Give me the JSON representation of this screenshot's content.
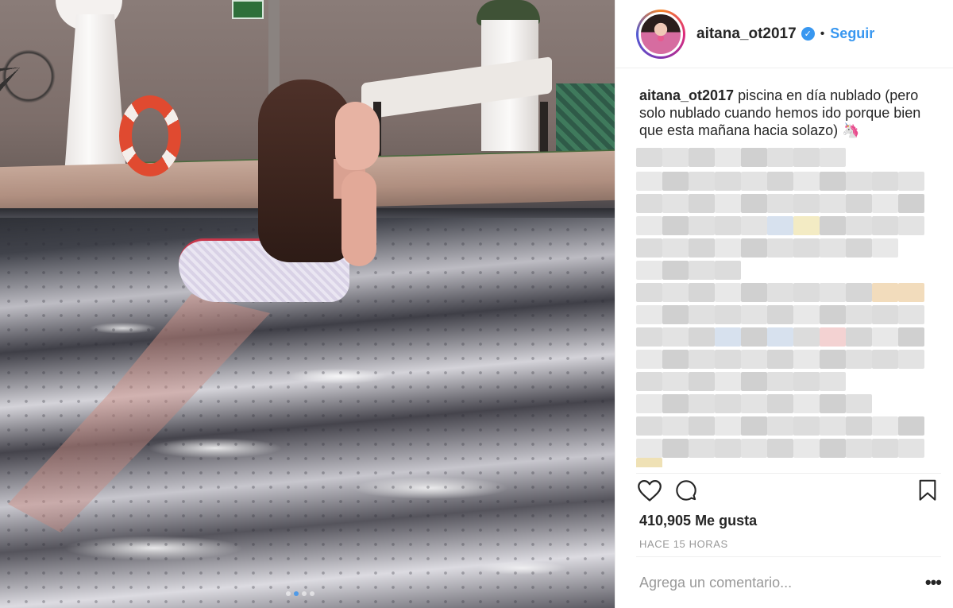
{
  "post": {
    "username": "aitana_ot2017",
    "verified": true,
    "separator": "•",
    "follow_label": "Seguir",
    "caption_user": "aitana_ot2017",
    "caption_text": "piscina en día nublado (pero solo nublado cuando hemos ido porque bien que esta mañana hacia solazo) 🦄",
    "likes": "410,905 Me gusta",
    "time": "HACE 15 HORAS",
    "comment_placeholder": "Agrega un comentario...",
    "more_label": "•••",
    "carousel": {
      "count": 4,
      "active": 2
    }
  },
  "colors": {
    "accent": "#3897f0",
    "text": "#262626",
    "muted": "#999999"
  },
  "icons": [
    "heart-icon",
    "comment-icon",
    "bookmark-icon",
    "verified-badge-icon",
    "more-options-icon"
  ]
}
